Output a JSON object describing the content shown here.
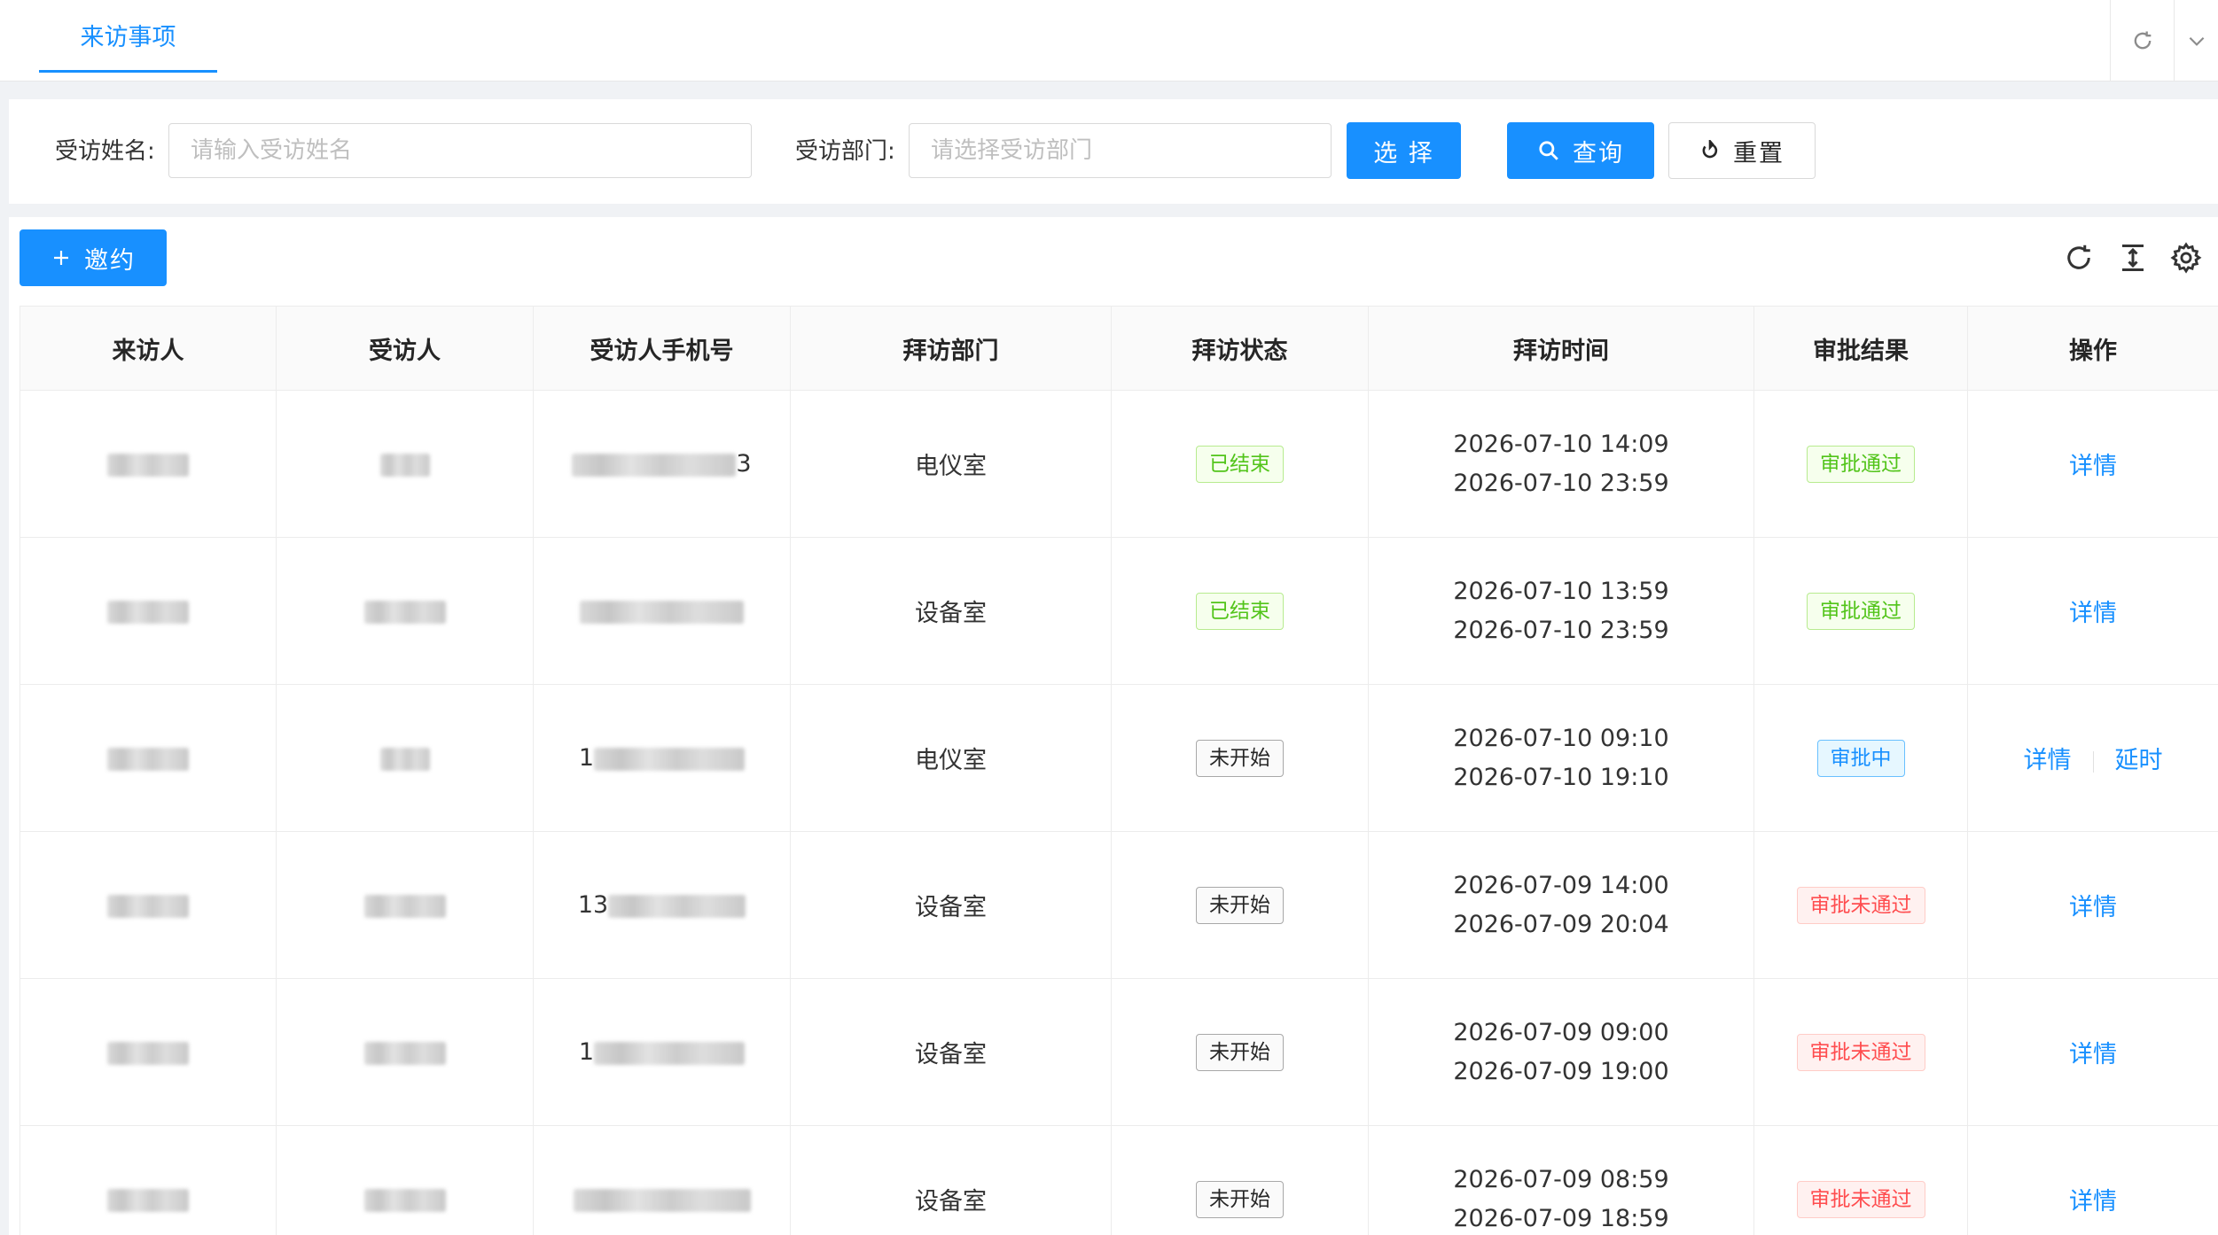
{
  "tabs": {
    "active": "来访事项"
  },
  "search": {
    "name_label": "受访姓名:",
    "name_placeholder": "请输入受访姓名",
    "dept_label": "受访部门:",
    "dept_placeholder": "请选择受访部门",
    "select_label": "选 择",
    "query_label": "查询",
    "reset_label": "重置"
  },
  "toolbar": {
    "invite_label": "邀约"
  },
  "table": {
    "columns": [
      "来访人",
      "受访人",
      "受访人手机号",
      "拜访部门",
      "拜访状态",
      "拜访时间",
      "审批结果",
      "操作"
    ],
    "rows": [
      {
        "phone_visible": "3",
        "dept": "电仪室",
        "status": "已结束",
        "status_type": "green",
        "start": "2026-07-10 14:09",
        "end": "2026-07-10 23:59",
        "result": "审批通过",
        "result_type": "green",
        "actions": [
          "详情"
        ]
      },
      {
        "phone_visible": "",
        "dept": "设备室",
        "status": "已结束",
        "status_type": "green",
        "start": "2026-07-10 13:59",
        "end": "2026-07-10 23:59",
        "result": "审批通过",
        "result_type": "green",
        "actions": [
          "详情"
        ]
      },
      {
        "phone_visible": "1",
        "dept": "电仪室",
        "status": "未开始",
        "status_type": "plain",
        "start": "2026-07-10 09:10",
        "end": "2026-07-10 19:10",
        "result": "审批中",
        "result_type": "blue",
        "actions": [
          "详情",
          "延时"
        ]
      },
      {
        "phone_visible": "13",
        "dept": "设备室",
        "status": "未开始",
        "status_type": "plain",
        "start": "2026-07-09 14:00",
        "end": "2026-07-09 20:04",
        "result": "审批未通过",
        "result_type": "red",
        "actions": [
          "详情"
        ]
      },
      {
        "phone_visible": "1",
        "dept": "设备室",
        "status": "未开始",
        "status_type": "plain",
        "start": "2026-07-09 09:00",
        "end": "2026-07-09 19:00",
        "result": "审批未通过",
        "result_type": "red",
        "actions": [
          "详情"
        ]
      },
      {
        "phone_visible": "",
        "dept": "设备室",
        "status": "未开始",
        "status_type": "plain",
        "start": "2026-07-09 08:59",
        "end": "2026-07-09 18:59",
        "result": "审批未通过",
        "result_type": "red",
        "actions": [
          "详情"
        ]
      }
    ]
  },
  "icons": {
    "tab_refresh": "refresh-icon",
    "tab_dropdown": "chevron-down-icon",
    "query": "search-icon",
    "reset": "reset-icon",
    "invite": "plus-icon",
    "table_refresh": "refresh-icon",
    "table_density": "column-height-icon",
    "table_settings": "gear-icon"
  },
  "colors": {
    "primary": "#1890ff",
    "success": "#52c41a",
    "error": "#ff4d4f",
    "page_bg": "#f0f2f5"
  }
}
